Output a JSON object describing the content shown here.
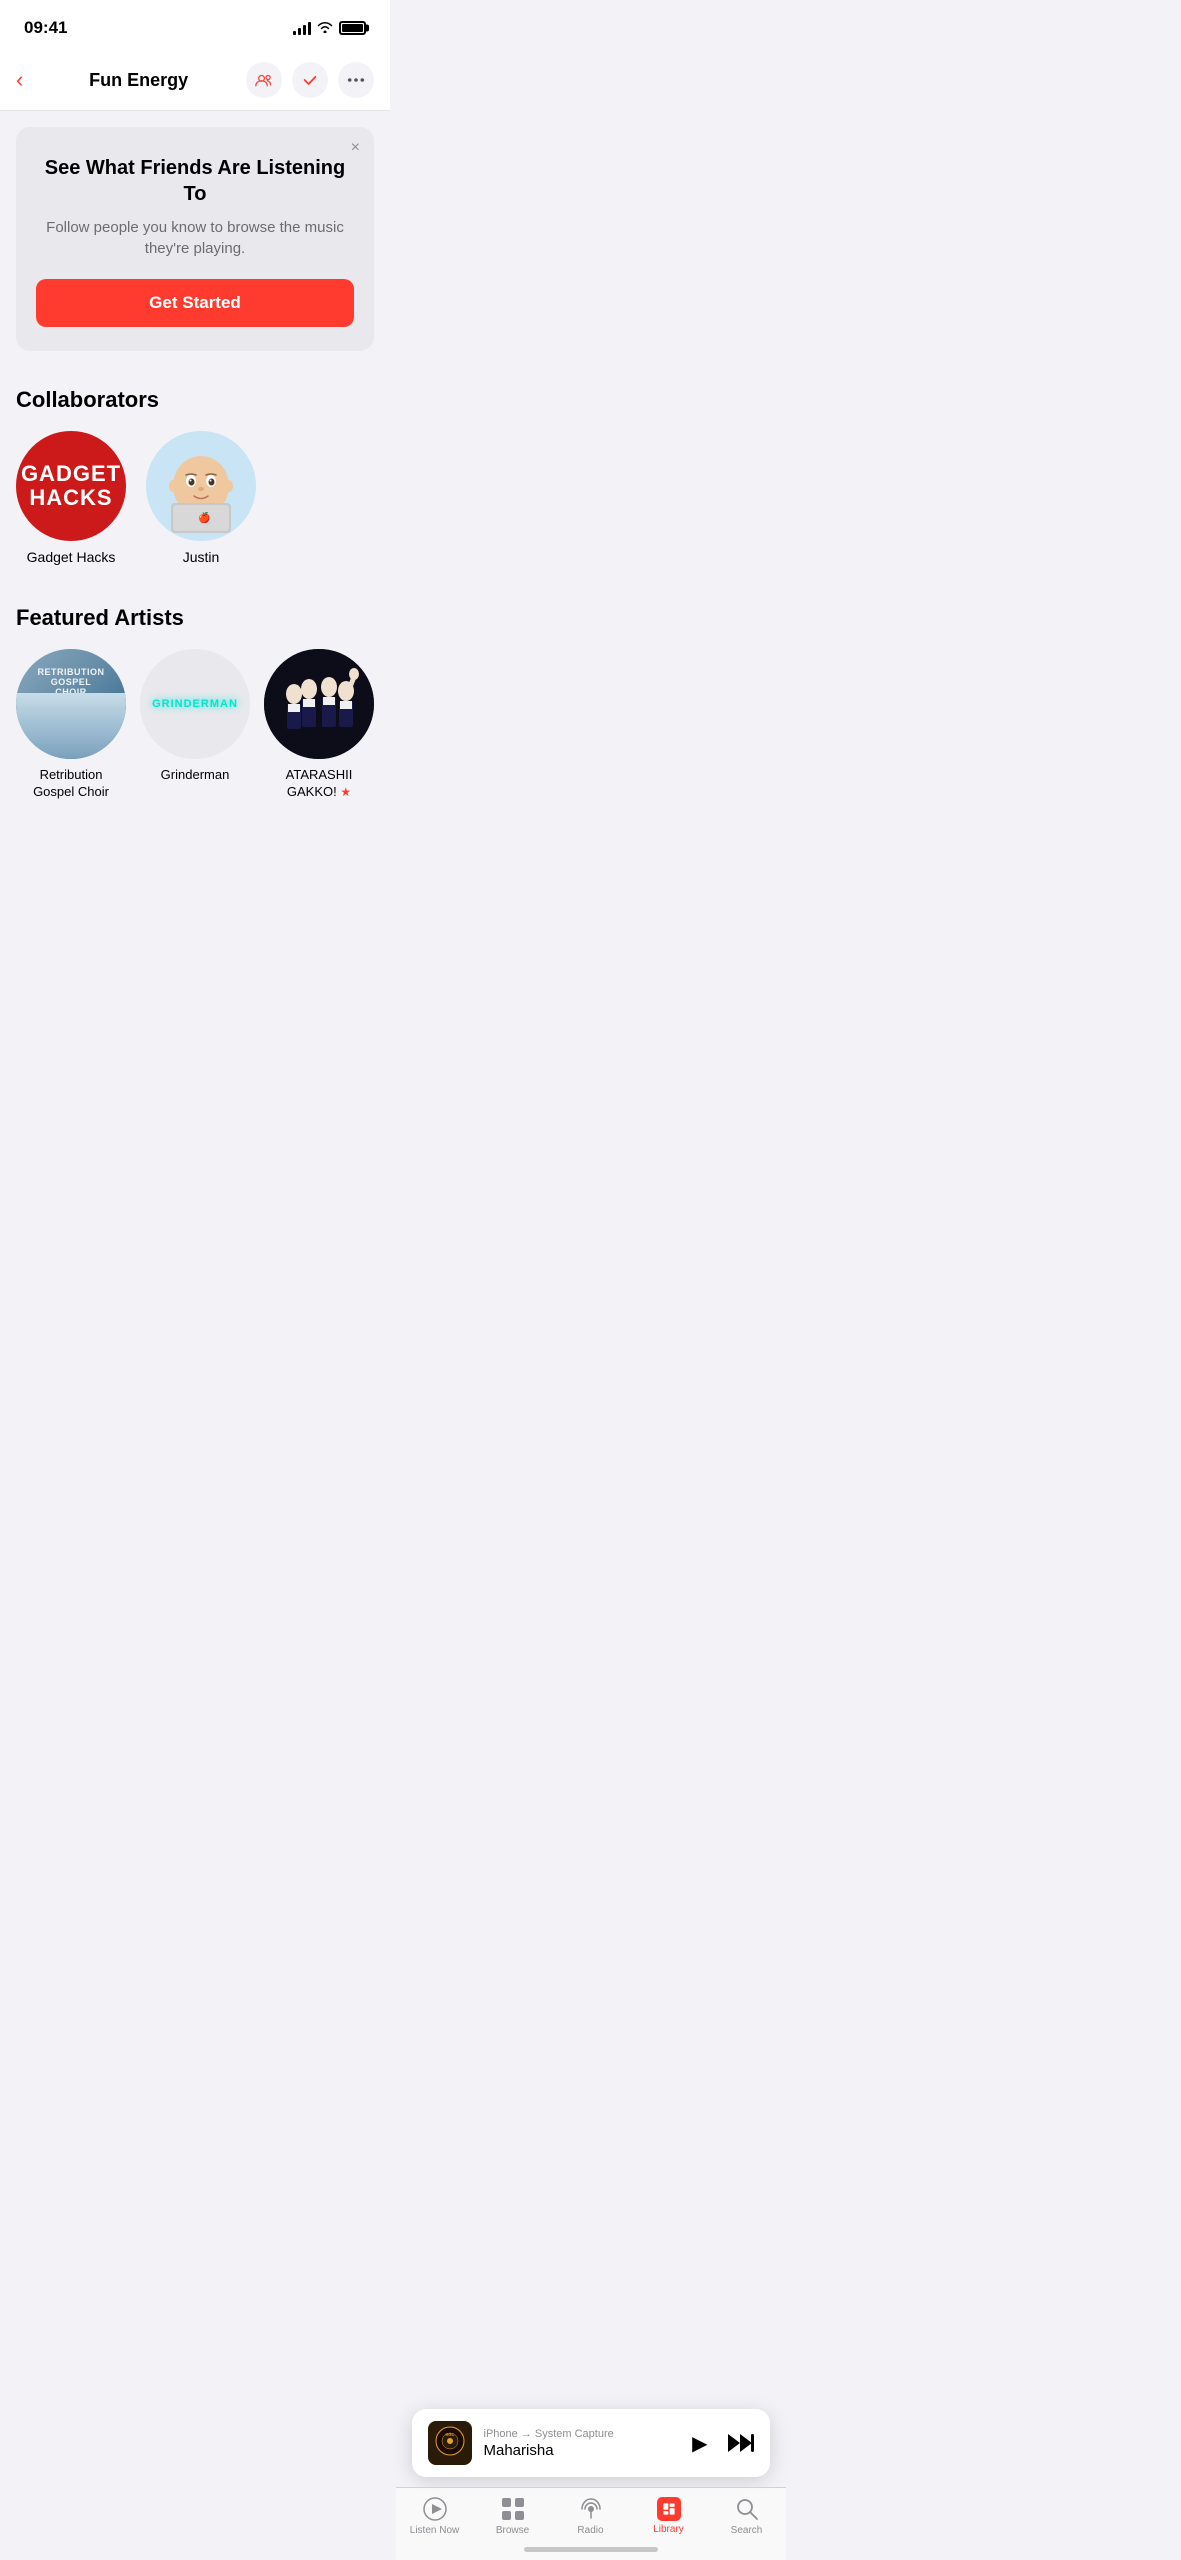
{
  "statusBar": {
    "time": "09:41",
    "signal": 4,
    "wifi": true,
    "battery": "full"
  },
  "navBar": {
    "title": "Fun Energy",
    "backLabel": "‹",
    "actions": {
      "friends": "friends-icon",
      "checkmark": "checkmark-icon",
      "more": "more-icon"
    }
  },
  "friendsBanner": {
    "title": "See What Friends Are Listening To",
    "description": "Follow people you know to browse the music they're playing.",
    "ctaLabel": "Get Started",
    "closeLabel": "×"
  },
  "collaborators": {
    "sectionTitle": "Collaborators",
    "items": [
      {
        "name": "Gadget Hacks",
        "type": "logo",
        "logoLine1": "GADGET",
        "logoLine2": "HACKS"
      },
      {
        "name": "Justin",
        "type": "avatar"
      }
    ]
  },
  "featuredArtists": {
    "sectionTitle": "Featured Artists",
    "items": [
      {
        "name": "Retribution Gospel Choir",
        "nameLines": [
          "Retribution",
          "Gospel Choir"
        ],
        "type": "album",
        "albumText": "RETRIBUTION GOSPEL CHOIR"
      },
      {
        "name": "Grinderman",
        "type": "logo",
        "logoText": "GRINDERMAN"
      },
      {
        "name": "ATARASHII GAKKO!",
        "type": "photo",
        "hasStar": true
      }
    ]
  },
  "nowPlaying": {
    "source": "iPhone → System Capture",
    "track": "Maharisha",
    "thumbLabel": "RGC",
    "playIcon": "▶",
    "skipIcon": "⏭"
  },
  "tabBar": {
    "tabs": [
      {
        "id": "listen-now",
        "label": "Listen Now",
        "icon": "▶",
        "active": false
      },
      {
        "id": "browse",
        "label": "Browse",
        "icon": "⊞",
        "active": false
      },
      {
        "id": "radio",
        "label": "Radio",
        "icon": "radio",
        "active": false
      },
      {
        "id": "library",
        "label": "Library",
        "icon": "library",
        "active": true
      },
      {
        "id": "search",
        "label": "Search",
        "icon": "⌕",
        "active": false
      }
    ]
  }
}
